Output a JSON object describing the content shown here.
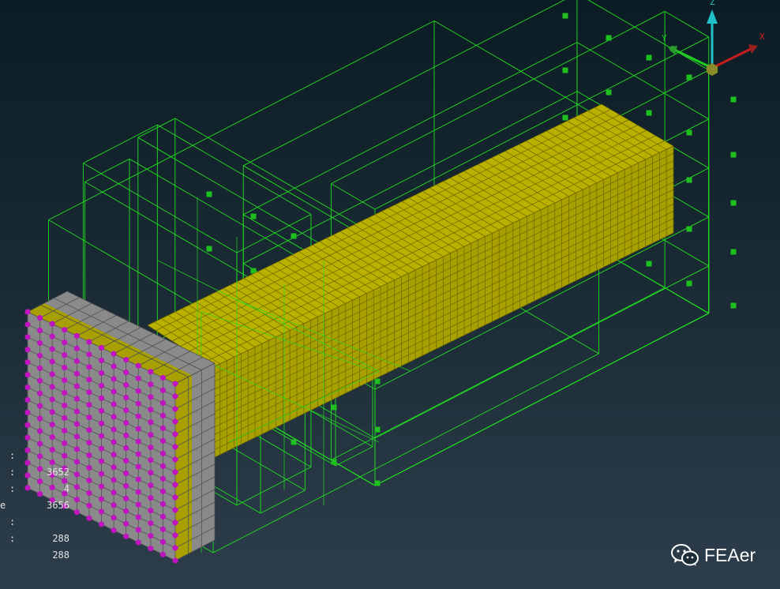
{
  "axes": {
    "x": "X",
    "y": "Y",
    "z": "Z"
  },
  "stats": [
    {
      "label": "",
      "value": "3652"
    },
    {
      "label": "",
      "value": "4"
    },
    {
      "label": "",
      "value": "3656"
    },
    {
      "label": "e",
      "value": ""
    },
    {
      "label": "",
      "value": "288"
    },
    {
      "label": "",
      "value": "288"
    }
  ],
  "watermark": {
    "text": "FEAer"
  },
  "colors": {
    "beam": "#a8a000",
    "beam_top": "#b9b000",
    "cell_lines": "#6b6600",
    "plate": "#8a8a8a",
    "plate_lines": "#505050",
    "nodes": "#c014c0",
    "frame": "#22dd22",
    "axis_x": "#d62020",
    "axis_y": "#22cc22",
    "axis_z": "#20c0c8"
  }
}
